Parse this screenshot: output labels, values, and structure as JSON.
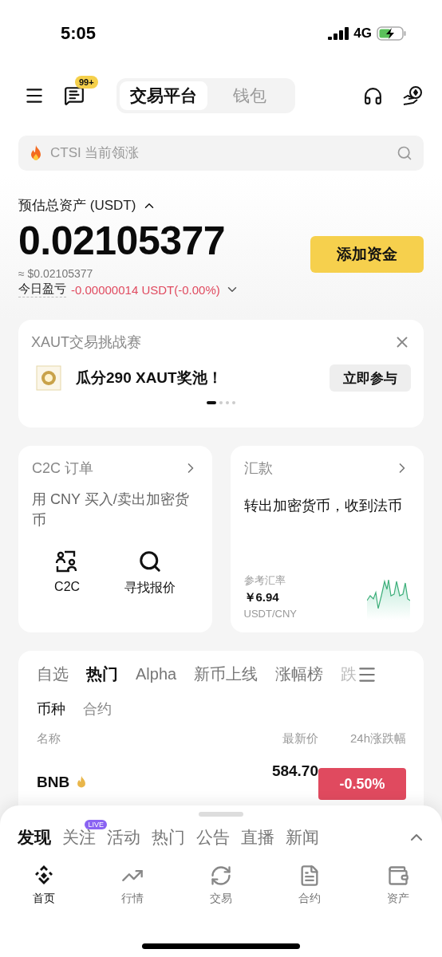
{
  "status_bar": {
    "time": "5:05",
    "network": "4G"
  },
  "header": {
    "badge": "99+",
    "segments": [
      {
        "label": "交易平台",
        "selected": true
      },
      {
        "label": "钱包",
        "selected": false
      }
    ]
  },
  "search": {
    "placeholder": "CTSI 当前领涨"
  },
  "assets": {
    "label": "预估总资产 (USDT)",
    "expanded": true,
    "total": "0.02105377",
    "approx": "≈ $0.02105377",
    "pnl_label": "今日盈亏",
    "pnl_value": "-0.00000014 USDT(-0.00%)",
    "add_button": "添加资金"
  },
  "banner": {
    "title": "XAUT交易挑战赛",
    "text": "瓜分290 XAUT奖池！",
    "button": "立即参与",
    "pages": [
      {
        "selected": true
      },
      {
        "selected": false
      },
      {
        "selected": false
      },
      {
        "selected": false
      }
    ]
  },
  "c2c_card": {
    "title": "C2C 订单",
    "description": "用 CNY 买入/卖出加密货币",
    "actions": [
      {
        "label": "C2C",
        "kind": "people"
      },
      {
        "label": "寻找报价",
        "kind": "search"
      }
    ]
  },
  "remit_card": {
    "title": "汇款",
    "description": "转出加密货币，收到法币",
    "rate_label": "参考汇率",
    "rate": "￥6.94",
    "pair": "USDT/CNY"
  },
  "market": {
    "tabs": [
      {
        "label": "自选",
        "selected": false
      },
      {
        "label": "热门",
        "selected": true
      },
      {
        "label": "Alpha",
        "selected": false
      },
      {
        "label": "新币上线",
        "selected": false
      },
      {
        "label": "涨幅榜",
        "selected": false
      },
      {
        "label": "跌",
        "selected": false
      }
    ],
    "subtabs": [
      {
        "label": "币种",
        "selected": true
      },
      {
        "label": "合约",
        "selected": false
      }
    ],
    "columns": [
      "名称",
      "最新价",
      "24h涨跌幅"
    ],
    "rows": [
      {
        "name": "BNB",
        "hot": true,
        "price": "584.70",
        "change": "-0.50%"
      }
    ]
  },
  "sheet": {
    "tabs": [
      {
        "label": "发现",
        "selected": true
      },
      {
        "label": "关注",
        "selected": false,
        "badge": "LIVE"
      },
      {
        "label": "活动",
        "selected": false
      },
      {
        "label": "热门",
        "selected": false
      },
      {
        "label": "公告",
        "selected": false
      },
      {
        "label": "直播",
        "selected": false
      },
      {
        "label": "新闻",
        "selected": false
      }
    ]
  },
  "nav": [
    {
      "label": "首页",
      "kind": "home",
      "selected": true
    },
    {
      "label": "行情",
      "kind": "markets",
      "selected": false
    },
    {
      "label": "交易",
      "kind": "trade",
      "selected": false
    },
    {
      "label": "合约",
      "kind": "futures",
      "selected": false
    },
    {
      "label": "资产",
      "kind": "assets",
      "selected": false
    }
  ]
}
